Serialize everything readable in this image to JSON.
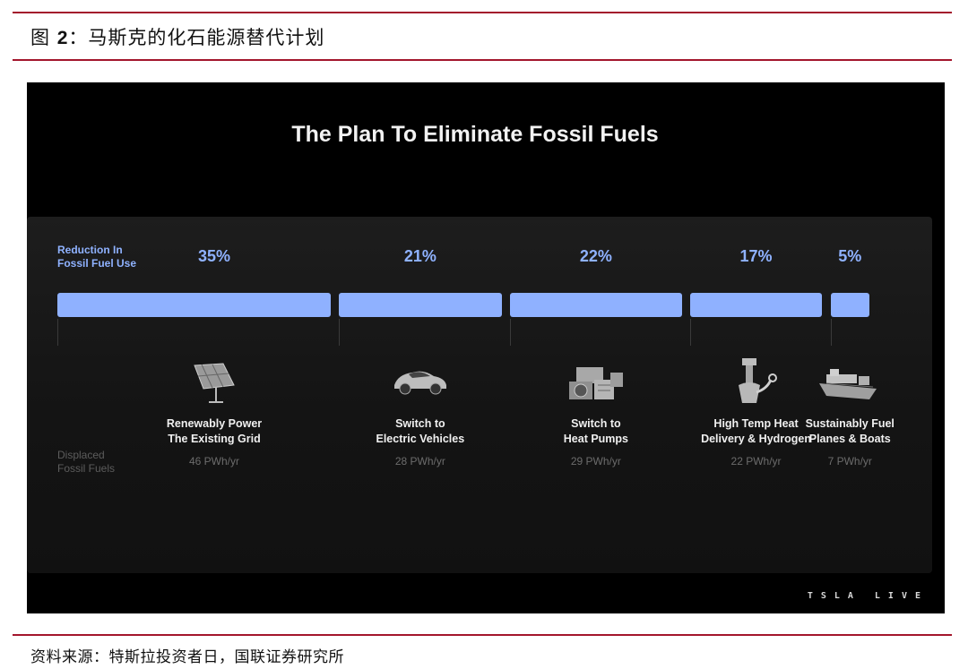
{
  "figure": {
    "title_prefix": "图",
    "title_num": "2",
    "title_text": "：马斯克的化石能源替代计划",
    "source": "资料来源：特斯拉投资者日，国联证券研究所"
  },
  "slide": {
    "title": "The Plan To Eliminate Fossil Fuels",
    "reduction_label_1": "Reduction In",
    "reduction_label_2": "Fossil Fuel Use",
    "displaced_label_1": "Displaced",
    "displaced_label_2": "Fossil Fuels",
    "logo": "TSLA LIVE"
  },
  "colors": {
    "bar": "#8fb1ff",
    "accent_rule": "#a3162c",
    "background": "#000000"
  },
  "chart_data": {
    "type": "bar",
    "title": "The Plan To Eliminate Fossil Fuels",
    "orientation": "horizontal-stacked",
    "categories": [
      [
        "Renewably Power",
        "The Existing Grid"
      ],
      [
        "Switch to",
        "Electric Vehicles"
      ],
      [
        "Switch to",
        "Heat Pumps"
      ],
      [
        "High Temp Heat",
        "Delivery & Hydrogen"
      ],
      [
        "Sustainably Fuel",
        "Planes & Boats"
      ]
    ],
    "values": [
      35,
      21,
      22,
      17,
      5
    ],
    "value_labels": [
      "35%",
      "21%",
      "22%",
      "17%",
      "5%"
    ],
    "displaced": [
      "46 PWh/yr",
      "28 PWh/yr",
      "29 PWh/yr",
      "22 PWh/yr",
      "7 PWh/yr"
    ],
    "icons": [
      "solar-panel-icon",
      "electric-car-icon",
      "heat-pump-icon",
      "hydrogen-furnace-icon",
      "ship-icon"
    ]
  }
}
